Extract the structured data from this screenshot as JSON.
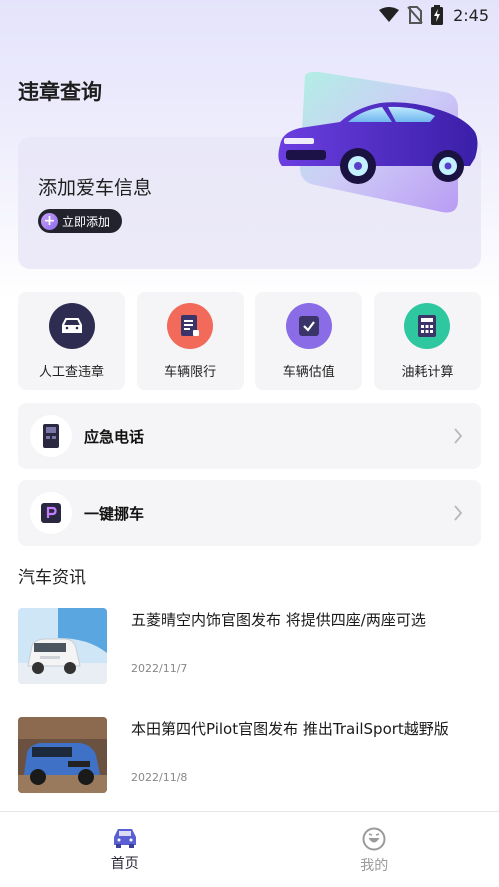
{
  "status_bar": {
    "time": "2:45"
  },
  "page": {
    "title": "违章查询"
  },
  "hero": {
    "title": "添加爱车信息",
    "button_label": "立即添加"
  },
  "features": [
    {
      "label": "人工查违章",
      "icon": "car-front-icon",
      "color": "#2f2c52"
    },
    {
      "label": "车辆限行",
      "icon": "document-icon",
      "color": "#f26a5a"
    },
    {
      "label": "车辆估值",
      "icon": "checkbox-icon",
      "color": "#8a6ce6"
    },
    {
      "label": "油耗计算",
      "icon": "calculator-icon",
      "color": "#2fc7a0"
    }
  ],
  "rows": [
    {
      "label": "应急电话",
      "icon": "phone-icon"
    },
    {
      "label": "一键挪车",
      "icon": "parking-icon"
    }
  ],
  "news_section": {
    "title": "汽车资讯"
  },
  "news": [
    {
      "title": "五菱晴空内饰官图发布 将提供四座/两座可选",
      "date": "2022/11/7"
    },
    {
      "title": "本田第四代Pilot官图发布 推出TrailSport越野版",
      "date": "2022/11/8"
    }
  ],
  "nav": [
    {
      "label": "首页",
      "icon": "car-icon",
      "active": true
    },
    {
      "label": "我的",
      "icon": "smiley-icon",
      "active": false
    }
  ],
  "colors": {
    "accent": "#5b5fd6",
    "dark": "#23232e"
  }
}
